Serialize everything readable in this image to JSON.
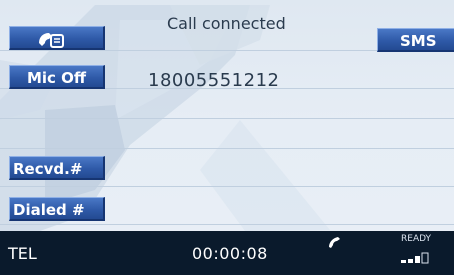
{
  "screen": {
    "status_text": "Call connected",
    "phone_number": "18005551212"
  },
  "buttons": {
    "phonebook_icon": "phonebook-icon",
    "mic_off": "Mic Off",
    "sms": "SMS",
    "received": "Recvd.#",
    "dialed": "Dialed #"
  },
  "status_bar": {
    "mode": "TEL",
    "timer": "00:00:08",
    "ready": "READY",
    "call_icon": "handset-icon",
    "signal_icon": "signal-bars-icon"
  },
  "colors": {
    "button_blue": "#2f5aa8",
    "status_bar": "#0a1a2c",
    "background": "#e6edf5"
  }
}
